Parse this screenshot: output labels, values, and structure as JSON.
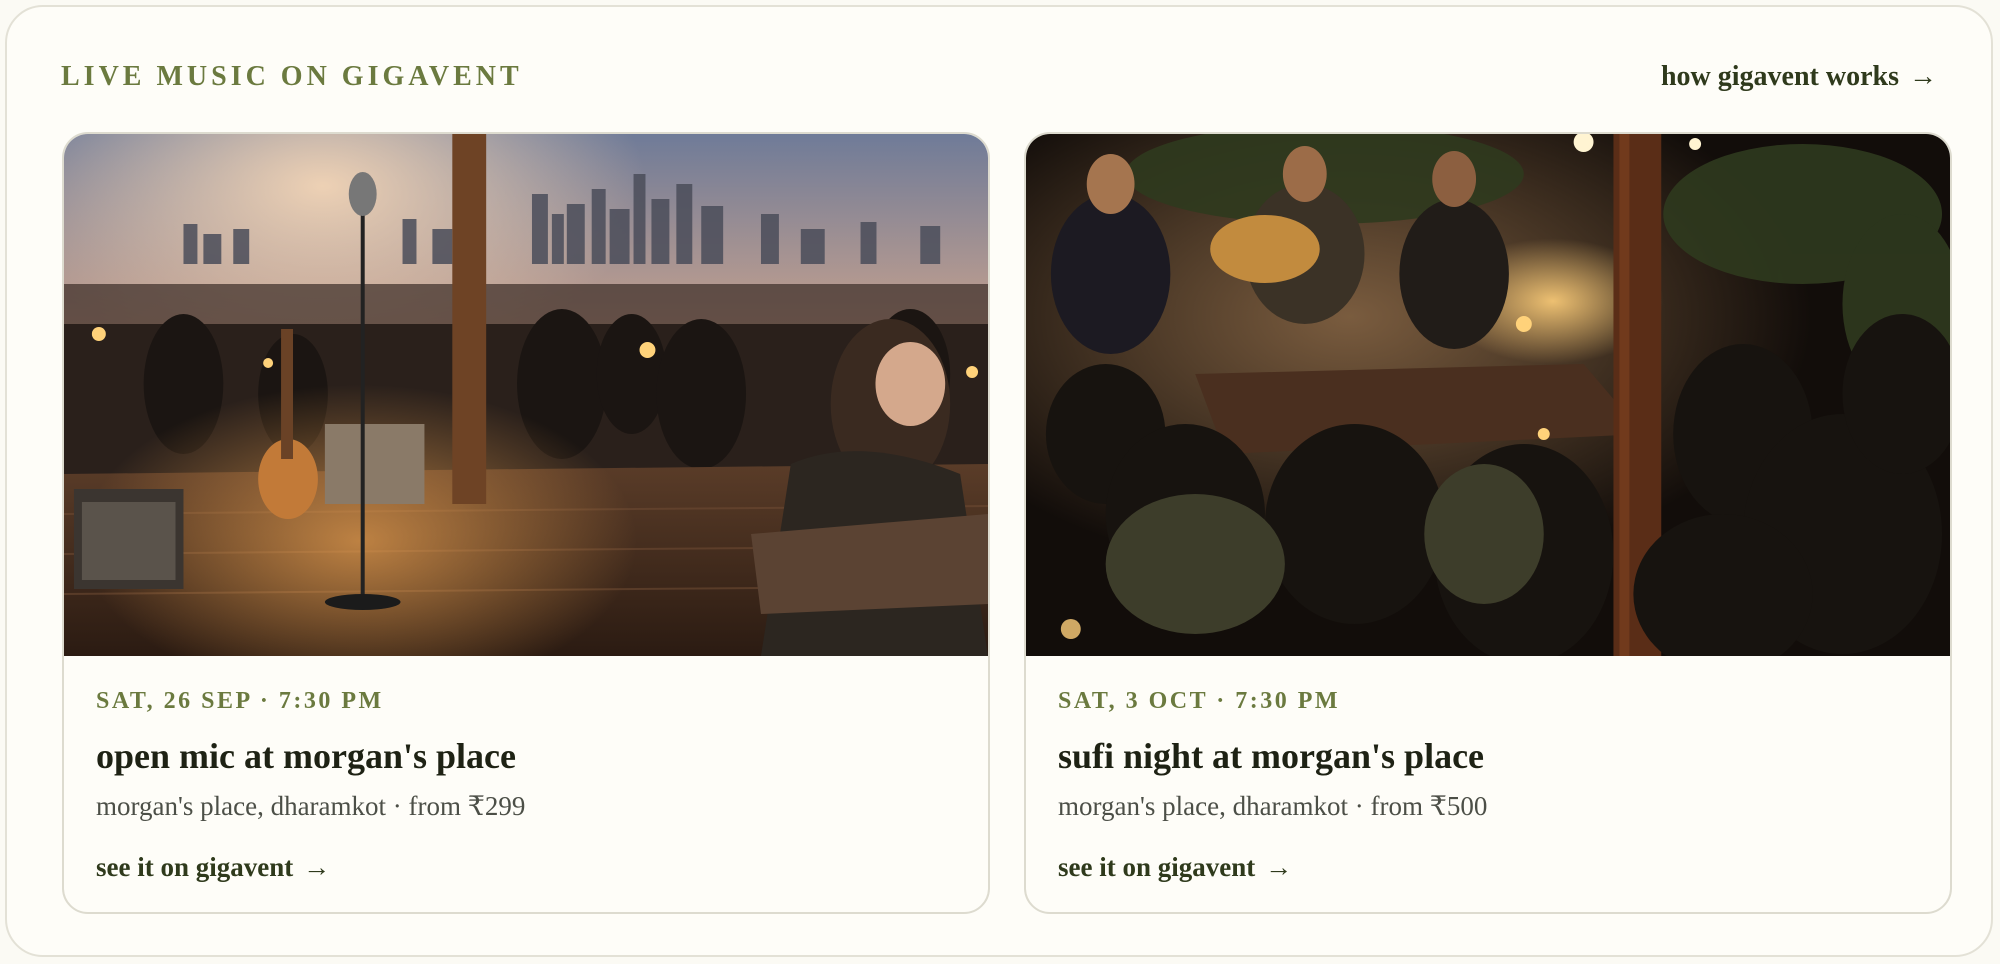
{
  "section": {
    "eyebrow": "LIVE MUSIC ON GIGAVENT",
    "how_link_label": "how gigavent works",
    "arrow": "→"
  },
  "events": [
    {
      "date": "SAT, 26 SEP · 7:30 PM",
      "title": "open mic at morgan's place",
      "meta": "morgan's place, dharamkot · from ₹299",
      "cta_label": "see it on gigavent",
      "arrow": "→"
    },
    {
      "date": "SAT, 3 OCT · 7:30 PM",
      "title": "sufi night at morgan's place",
      "meta": "morgan's place, dharamkot · from ₹500",
      "cta_label": "see it on gigavent",
      "arrow": "→"
    }
  ],
  "colors": {
    "accent": "#6b7a3f",
    "link": "#2f3a1c",
    "background": "#fefdf8"
  }
}
